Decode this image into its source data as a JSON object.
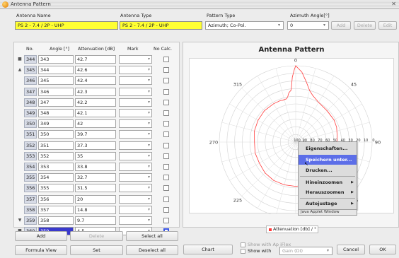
{
  "window": {
    "title": "Antenna Pattern",
    "close_glyph": "✕"
  },
  "header": {
    "antenna_name_label": "Antenna Name",
    "antenna_name_value": "PS 2 - 7.4 / 2P - UHP",
    "antenna_type_label": "Antenna Type",
    "antenna_type_value": "PS 2 - 7.4 / 2P - UHP",
    "pattern_type_label": "Pattern Type",
    "pattern_type_value": "Azimuth; Co-Pol.",
    "azimuth_angle_label": "Azimuth Angle[°]",
    "azimuth_angle_value": "0",
    "add_label": "Add",
    "delete_label": "Delete",
    "edit_label": "Edit"
  },
  "table": {
    "columns": [
      "No.",
      "Angle [°]",
      "Attenuation [dB]",
      "Mark",
      "No Calc."
    ],
    "rows": [
      {
        "no": "344",
        "angle": "343",
        "att": "42.7"
      },
      {
        "no": "345",
        "angle": "344",
        "att": "42.6"
      },
      {
        "no": "346",
        "angle": "345",
        "att": "42.4"
      },
      {
        "no": "347",
        "angle": "346",
        "att": "42.3"
      },
      {
        "no": "348",
        "angle": "347",
        "att": "42.2"
      },
      {
        "no": "349",
        "angle": "348",
        "att": "42.1"
      },
      {
        "no": "350",
        "angle": "349",
        "att": "42"
      },
      {
        "no": "351",
        "angle": "350",
        "att": "39.7"
      },
      {
        "no": "352",
        "angle": "351",
        "att": "37.3"
      },
      {
        "no": "353",
        "angle": "352",
        "att": "35"
      },
      {
        "no": "354",
        "angle": "353",
        "att": "33.8"
      },
      {
        "no": "355",
        "angle": "354",
        "att": "32.7"
      },
      {
        "no": "356",
        "angle": "355",
        "att": "31.5"
      },
      {
        "no": "357",
        "angle": "356",
        "att": "20"
      },
      {
        "no": "358",
        "angle": "357",
        "att": "14.8"
      },
      {
        "no": "359",
        "angle": "358",
        "att": "9.7"
      },
      {
        "no": "360",
        "angle": "359",
        "att": "4.5"
      }
    ],
    "selected_row": 16
  },
  "bottom_left": {
    "add_label": "Add",
    "delete_label": "Delete",
    "select_all_label": "Select all",
    "formula_view_label": "Formula View",
    "set_label": "Set",
    "deselect_all_label": "Deselect all"
  },
  "chart": {
    "title": "Antenna Pattern",
    "legend_label": "Attenuation [db] / °",
    "angle_labels": [
      "0",
      "45",
      "90",
      "135",
      "180",
      "225",
      "270",
      "315"
    ],
    "radial_labels": [
      "100",
      "90",
      "80",
      "70",
      "60",
      "50",
      "40",
      "30",
      "20",
      "10",
      "0"
    ],
    "series_color": "#ff3b3b"
  },
  "chart_data": {
    "type": "polar",
    "title": "Antenna Pattern",
    "angle_ticks": [
      0,
      45,
      90,
      135,
      180,
      225,
      270,
      315
    ],
    "radial_ticks": [
      100,
      90,
      80,
      70,
      60,
      50,
      40,
      30,
      20,
      10,
      0
    ],
    "series": [
      {
        "name": "Attenuation [db] / °",
        "angles": [
          0,
          5,
          10,
          15,
          20,
          30,
          45,
          60,
          70,
          80,
          90,
          100,
          110,
          120,
          135,
          150,
          165,
          180,
          195,
          210,
          225,
          240,
          255,
          270,
          285,
          300,
          315,
          330,
          340,
          343,
          345,
          348,
          350,
          352,
          355,
          357,
          359
        ],
        "values": [
          0,
          8,
          20,
          30,
          35,
          40,
          42,
          42,
          43,
          45,
          46,
          45,
          44,
          43,
          43,
          42,
          42,
          42,
          42,
          42,
          43,
          45,
          45,
          46,
          44,
          43,
          42,
          42,
          42,
          42.7,
          42.4,
          42.1,
          39.7,
          35,
          31.5,
          14.8,
          4.5
        ]
      }
    ],
    "rlim": [
      0,
      100
    ]
  },
  "context_menu": {
    "items": [
      "Eigenschaften...",
      "Speichern unter...",
      "Drucken...",
      "Hineinzoomen",
      "Herauszoomen",
      "Autojustage"
    ],
    "highlighted": 1,
    "footer": "Java Applet Window"
  },
  "bottom_right": {
    "chart_label": "Chart",
    "show_with_ap_label": "Show with Ap iFlex",
    "show_with_label": "Show with",
    "gain_value": "Gain (DI)",
    "cancel_label": "Cancel",
    "ok_label": "OK"
  }
}
